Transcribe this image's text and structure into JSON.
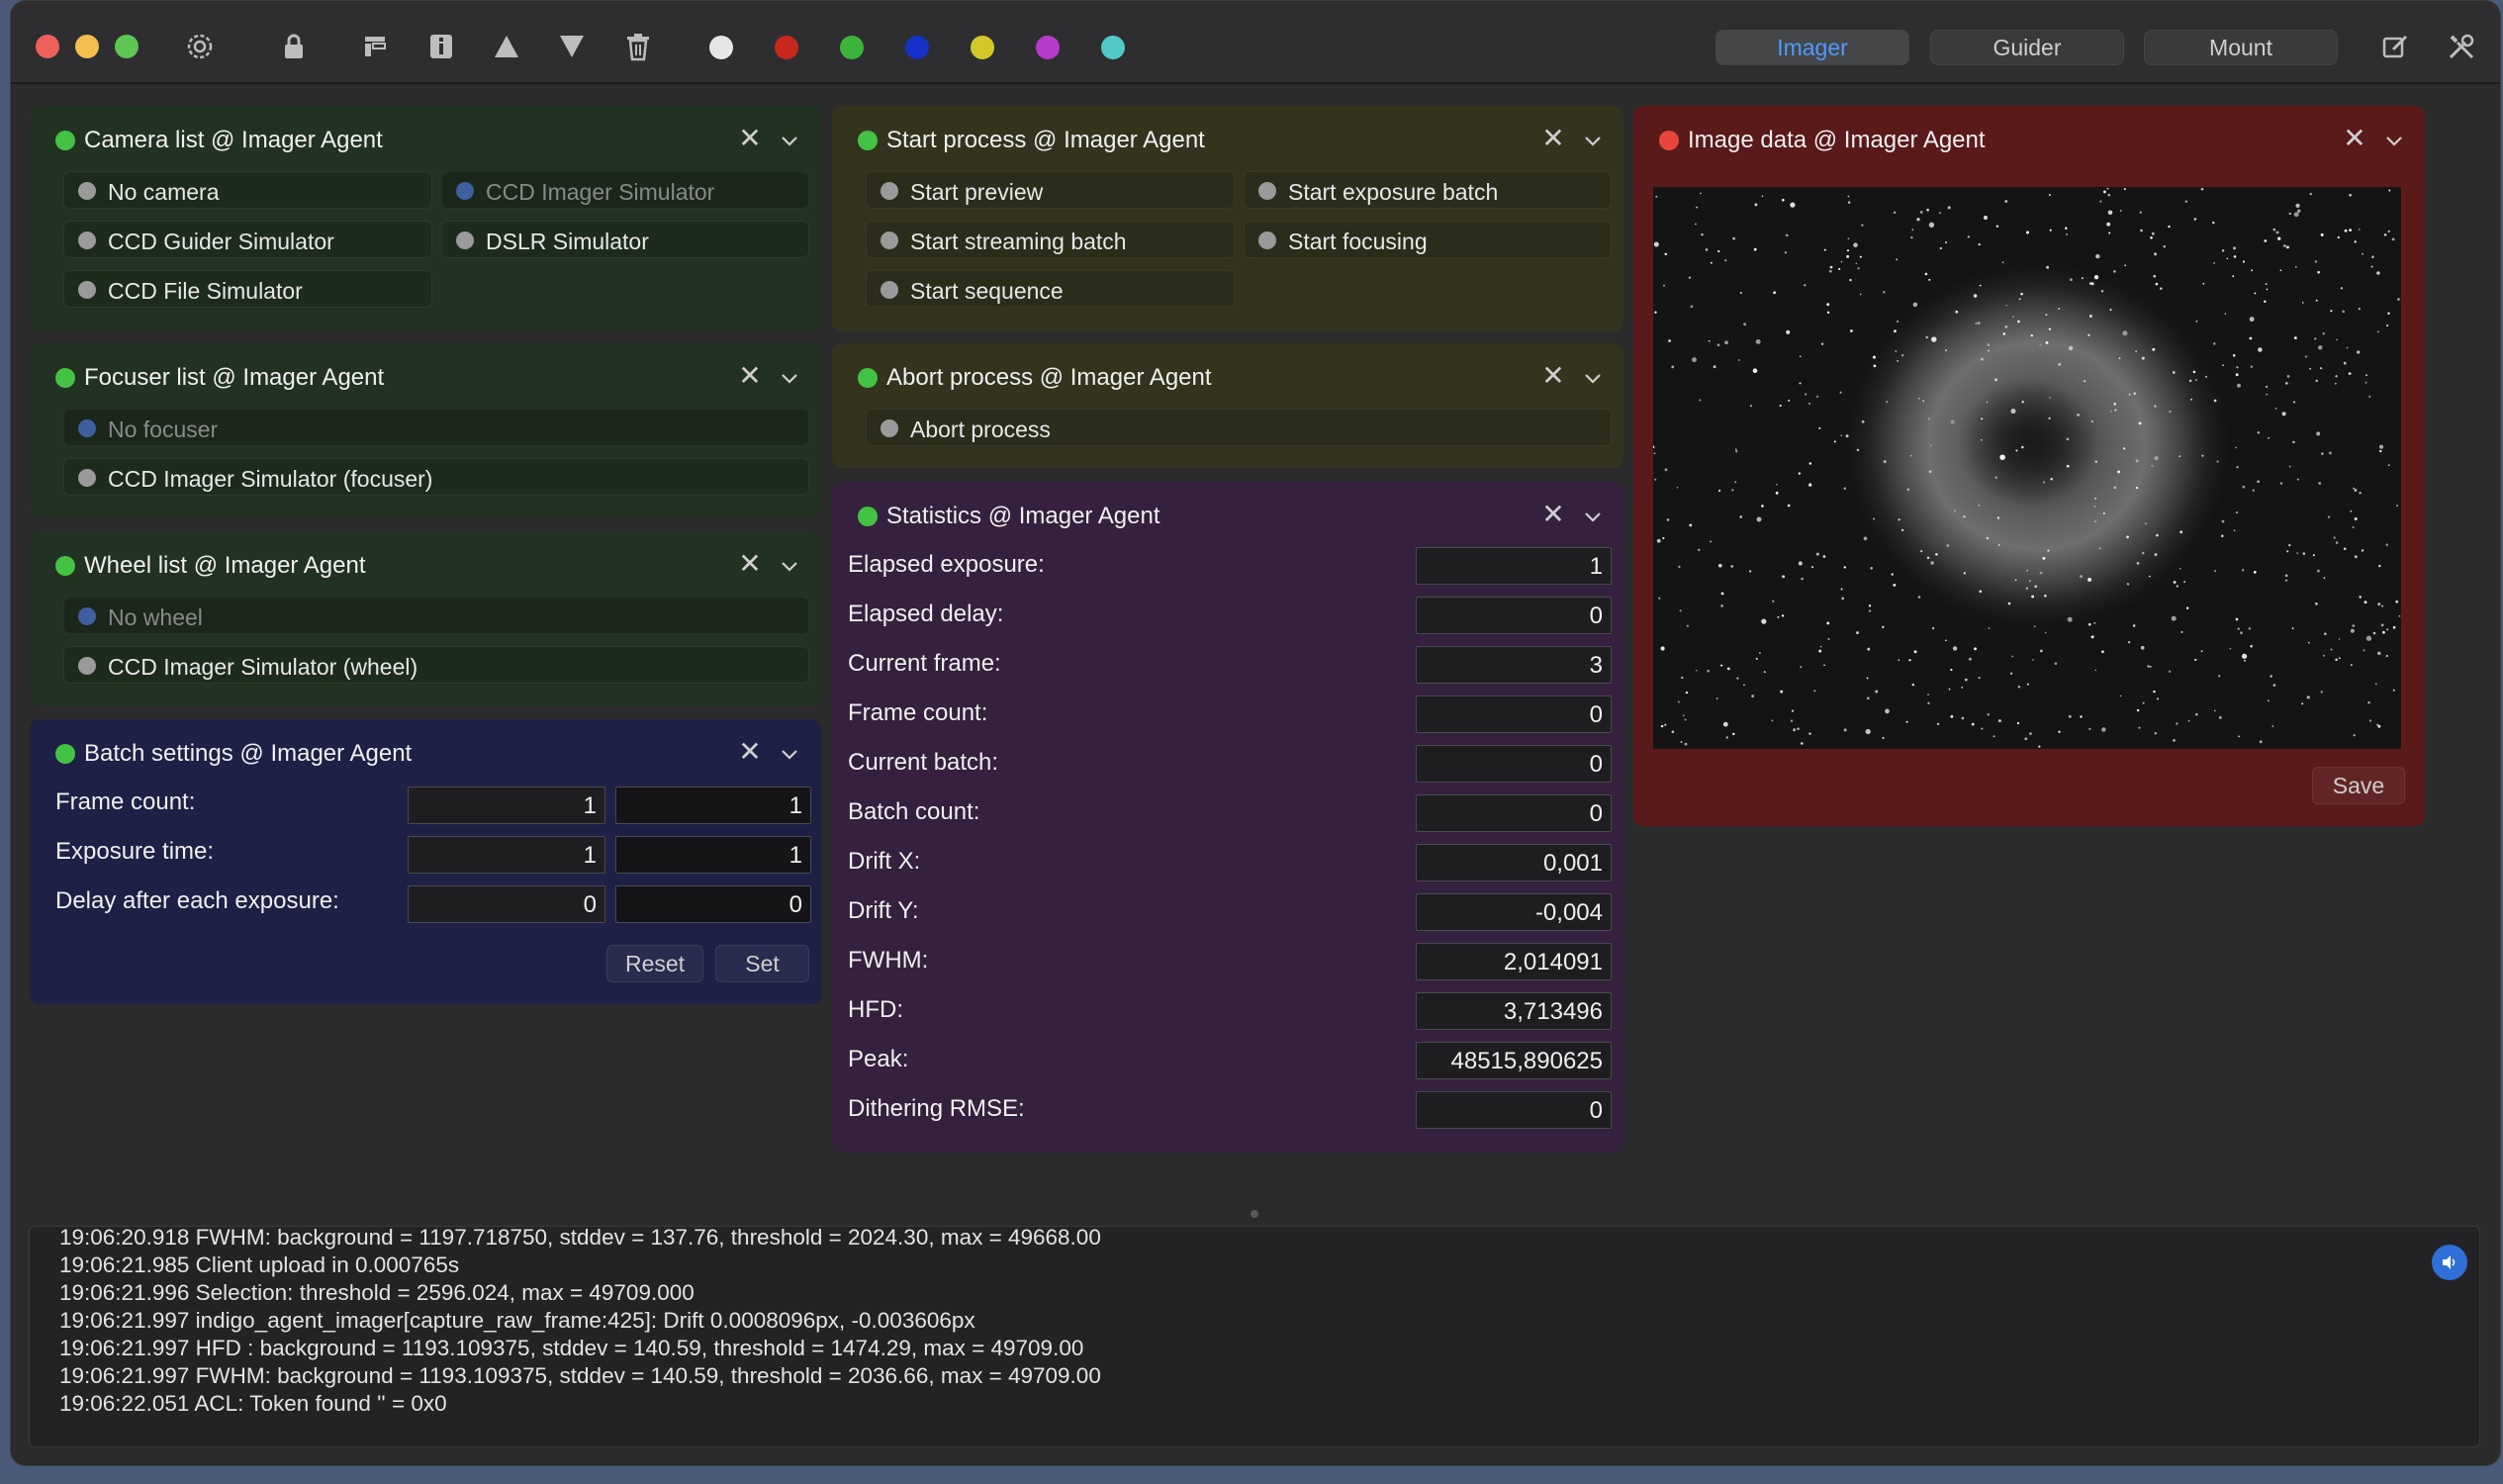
{
  "toolbar": {
    "agents": [
      {
        "label": "Imager",
        "active": true
      },
      {
        "label": "Guider",
        "active": false
      },
      {
        "label": "Mount",
        "active": false
      }
    ],
    "colors": [
      "#e6e6e6",
      "#c8281e",
      "#3cb43c",
      "#1432c8",
      "#d2c828",
      "#b43cc8",
      "#50c8c8"
    ]
  },
  "panels": {
    "camera": {
      "title": "Camera list @ Imager Agent",
      "items": [
        "No camera",
        "CCD Imager Simulator",
        "CCD Guider Simulator",
        "DSLR Simulator",
        "CCD File Simulator"
      ]
    },
    "focuser": {
      "title": "Focuser list @ Imager Agent",
      "items": [
        "No focuser",
        "CCD Imager Simulator (focuser)"
      ]
    },
    "wheel": {
      "title": "Wheel list @ Imager Agent",
      "items": [
        "No wheel",
        "CCD Imager Simulator (wheel)"
      ]
    },
    "batch": {
      "title": "Batch settings @ Imager Agent",
      "rows": [
        {
          "label": "Frame count:",
          "value": "1",
          "target": "1"
        },
        {
          "label": "Exposure time:",
          "value": "1",
          "target": "1"
        },
        {
          "label": "Delay after each exposure:",
          "value": "0",
          "target": "0"
        }
      ],
      "reset_label": "Reset",
      "set_label": "Set"
    },
    "start": {
      "title": "Start process @ Imager Agent",
      "items": [
        "Start preview",
        "Start exposure batch",
        "Start streaming batch",
        "Start focusing",
        "Start sequence"
      ]
    },
    "abort": {
      "title": "Abort process @ Imager Agent",
      "items": [
        "Abort process"
      ]
    },
    "stats": {
      "title": "Statistics @ Imager Agent",
      "rows": [
        {
          "label": "Elapsed exposure:",
          "value": "1"
        },
        {
          "label": "Elapsed delay:",
          "value": "0"
        },
        {
          "label": "Current frame:",
          "value": "3"
        },
        {
          "label": "Frame count:",
          "value": "0"
        },
        {
          "label": "Current batch:",
          "value": "0"
        },
        {
          "label": "Batch count:",
          "value": "0"
        },
        {
          "label": "Drift X:",
          "value": "0,001"
        },
        {
          "label": "Drift Y:",
          "value": "-0,004"
        },
        {
          "label": "FWHM:",
          "value": "2,014091"
        },
        {
          "label": "HFD:",
          "value": "3,713496"
        },
        {
          "label": "Peak:",
          "value": "48515,890625"
        },
        {
          "label": "Dithering RMSE:",
          "value": "0"
        }
      ]
    },
    "image": {
      "title": "Image data @ Imager Agent",
      "save_label": "Save"
    }
  },
  "log": [
    "19:06:20.918 FWHM: background = 1197.718750, stddev = 137.76, threshold = 2024.30, max = 49668.00",
    "19:06:21.985 Client upload in 0.000765s",
    "19:06:21.996 Selection: threshold = 2596.024, max = 49709.000",
    "19:06:21.997 indigo_agent_imager[capture_raw_frame:425]: Drift 0.0008096px, -0.003606px",
    "19:06:21.997 HFD : background = 1193.109375, stddev = 140.59, threshold = 1474.29, max = 49709.00",
    "19:06:21.997 FWHM: background = 1193.109375, stddev = 140.59, threshold = 2036.66, max = 49709.00",
    "19:06:22.051 ACL: Token found '' = 0x0"
  ]
}
